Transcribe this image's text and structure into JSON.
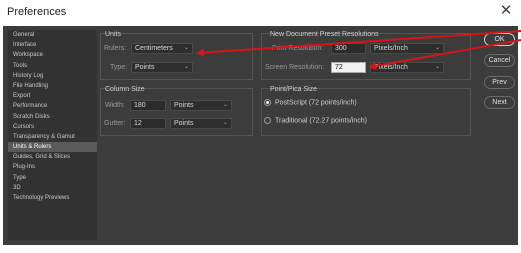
{
  "window": {
    "title": "Preferences",
    "close_glyph": "✕"
  },
  "sidebar": {
    "items": [
      "General",
      "Interface",
      "Workspace",
      "Tools",
      "History Log",
      "File Handling",
      "Export",
      "Performance",
      "Scratch Disks",
      "Cursors",
      "Transparency & Gamut",
      "Units & Rulers",
      "Guides, Grid & Slices",
      "Plug-Ins",
      "Type",
      "3D",
      "Technology Previews"
    ],
    "active_index": 11
  },
  "units": {
    "title": "Units",
    "rulers_label": "Rulers:",
    "rulers_value": "Centimeters",
    "type_label": "Type:",
    "type_value": "Points"
  },
  "column_size": {
    "title": "Column Size",
    "width_label": "Width:",
    "width_value": "180",
    "width_unit": "Points",
    "gutter_label": "Gutter:",
    "gutter_value": "12",
    "gutter_unit": "Points"
  },
  "presets": {
    "title": "New Document Preset Resolutions",
    "print_label": "Print Resolution:",
    "print_value": "300",
    "print_unit": "Pixels/Inch",
    "screen_label": "Screen Resolution:",
    "screen_value": "72",
    "screen_unit": "Pixels/Inch"
  },
  "point_size": {
    "title": "Point/Pica Size",
    "option1": "PostScript (72 points/inch)",
    "option2": "Traditional (72.27 points/inch)",
    "selected": 1
  },
  "buttons": {
    "ok": "OK",
    "cancel": "Cancel",
    "prev": "Prev",
    "next": "Next"
  },
  "colors": {
    "annotation_arrow": "#d8141a",
    "dialog_bg": "#3c3c3c"
  }
}
